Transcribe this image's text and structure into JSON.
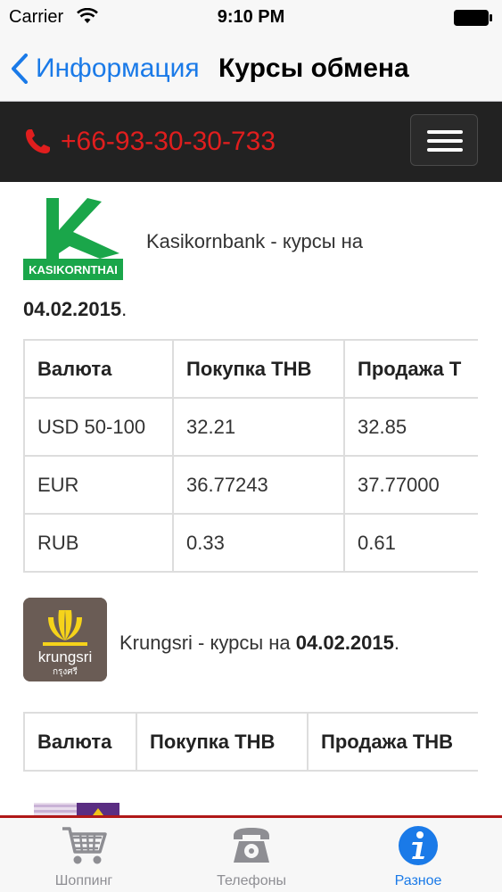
{
  "status_bar": {
    "carrier": "Carrier",
    "time": "9:10 PM"
  },
  "nav_bar": {
    "back_label": "Информация",
    "title": "Курсы обмена"
  },
  "site_header": {
    "phone": "+66-93-30-30-733",
    "phone_color": "#e01e1e"
  },
  "banks": [
    {
      "logo_text": "KASIKORNTHAI",
      "heading_prefix": "Kasikornbank - курсы на",
      "date": "04.02.2015",
      "date_suffix": ".",
      "headers": [
        "Валюта",
        "Покупка THB",
        "Продажа T"
      ],
      "rows": [
        [
          "USD 50-100",
          "32.21",
          "32.85"
        ],
        [
          "EUR",
          "36.77243",
          "37.77000"
        ],
        [
          "RUB",
          "0.33",
          "0.61"
        ]
      ]
    },
    {
      "logo_text": "krungsri",
      "logo_subtext": "กรุงศรี",
      "heading_prefix": "Krungsri - курсы на",
      "date": "04.02.2015",
      "date_suffix": ".",
      "headers": [
        "Валюта",
        "Покупка THB",
        "Продажа THB"
      ]
    }
  ],
  "tab_bar": {
    "tabs": [
      {
        "label": "Шоппинг",
        "icon": "shopping-cart-icon",
        "active": false
      },
      {
        "label": "Телефоны",
        "icon": "telephone-icon",
        "active": false
      },
      {
        "label": "Разное",
        "icon": "info-icon",
        "active": true
      }
    ]
  },
  "colors": {
    "accent": "#1a7ae8",
    "header_bg": "#222222",
    "tab_border": "#b01818"
  }
}
